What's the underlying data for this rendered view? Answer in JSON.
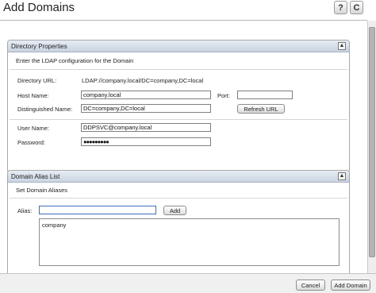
{
  "header": {
    "title": "Add Domains",
    "help_glyph": "?",
    "refresh_glyph": "C",
    "icons": [
      "help-icon",
      "refresh-icon"
    ]
  },
  "directory_properties": {
    "title": "Directory Properties",
    "description": "Enter the LDAP configuration for the Domain",
    "directory_url_label": "Directory URL:",
    "directory_url_value": "LDAP://company.local/DC=company,DC=local",
    "host_name_label": "Host Name:",
    "host_name_value": "company.local",
    "port_label": "Port:",
    "port_value": "",
    "distinguished_name_label": "Distinguished Name:",
    "distinguished_name_value": "DC=company,DC=local",
    "refresh_url_label": "Refresh URL",
    "user_name_label": "User Name:",
    "user_name_value": "DDPSVC@company.local",
    "password_label": "Password:",
    "password_value": "●●●●●●●●●",
    "collapse_glyph": "▲"
  },
  "domain_alias": {
    "title": "Domain Alias List",
    "description": "Set Domain Aliases",
    "alias_label": "Alias:",
    "alias_value": "",
    "add_label": "Add",
    "aliases": [
      "company"
    ],
    "collapse_glyph": "▲"
  },
  "footer": {
    "cancel_label": "Cancel",
    "add_domain_label": "Add Domain"
  }
}
